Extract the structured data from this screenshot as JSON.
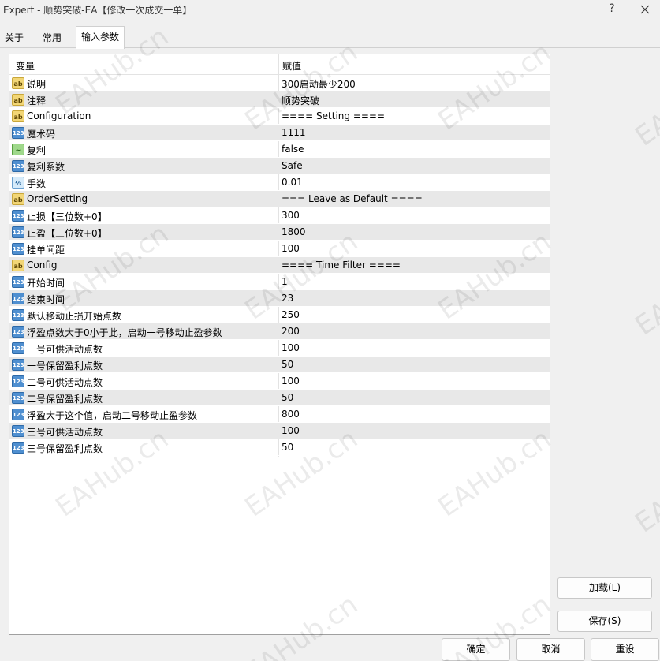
{
  "window": {
    "title": "Expert - 顺势突破-EA【修改一次成交一单】",
    "help_label": "?"
  },
  "tabs": [
    {
      "label": "关于"
    },
    {
      "label": "常用"
    },
    {
      "label": "输入参数"
    }
  ],
  "grid": {
    "col_variable": "变量",
    "col_value": "赋值",
    "rows": [
      {
        "type": "ab",
        "name": "说明",
        "value": "300启动最少200"
      },
      {
        "type": "ab",
        "name": "注释",
        "value": "顺势突破"
      },
      {
        "type": "ab",
        "name": "Configuration",
        "value": "==== Setting ===="
      },
      {
        "type": "num",
        "name": "魔术码",
        "value": "1111"
      },
      {
        "type": "bool",
        "name": "复利",
        "value": "false"
      },
      {
        "type": "num",
        "name": "复利系数",
        "value": "Safe"
      },
      {
        "type": "frac",
        "name": "手数",
        "value": "0.01"
      },
      {
        "type": "ab",
        "name": "OrderSetting",
        "value": "=== Leave as Default ===="
      },
      {
        "type": "num",
        "name": "止损【三位数+0】",
        "value": "300"
      },
      {
        "type": "num",
        "name": "止盈【三位数+0】",
        "value": "1800"
      },
      {
        "type": "num",
        "name": "挂单间距",
        "value": "100"
      },
      {
        "type": "ab",
        "name": "Config",
        "value": "==== Time Filter ===="
      },
      {
        "type": "num",
        "name": "开始时间",
        "value": "1"
      },
      {
        "type": "num",
        "name": "结束时间",
        "value": "23"
      },
      {
        "type": "num",
        "name": "默认移动止损开始点数",
        "value": "250"
      },
      {
        "type": "num",
        "name": "浮盈点数大于0小于此，启动一号移动止盈参数",
        "value": "200"
      },
      {
        "type": "num",
        "name": "一号可供活动点数",
        "value": "100"
      },
      {
        "type": "num",
        "name": "一号保留盈利点数",
        "value": "50"
      },
      {
        "type": "num",
        "name": "二号可供活动点数",
        "value": "100"
      },
      {
        "type": "num",
        "name": "二号保留盈利点数",
        "value": "50"
      },
      {
        "type": "num",
        "name": "浮盈大于这个值，启动二号移动止盈参数",
        "value": "800"
      },
      {
        "type": "num",
        "name": "三号可供活动点数",
        "value": "100"
      },
      {
        "type": "num",
        "name": "三号保留盈利点数",
        "value": "50"
      }
    ]
  },
  "icon_glyphs": {
    "ab": "ab",
    "num": "123",
    "bool": "~",
    "frac": "½"
  },
  "side_buttons": {
    "load": "加载(L)",
    "save": "保存(S)"
  },
  "bottom_buttons": {
    "ok": "确定",
    "cancel": "取消",
    "reset": "重设"
  },
  "watermark_text": "EAHub.cn"
}
